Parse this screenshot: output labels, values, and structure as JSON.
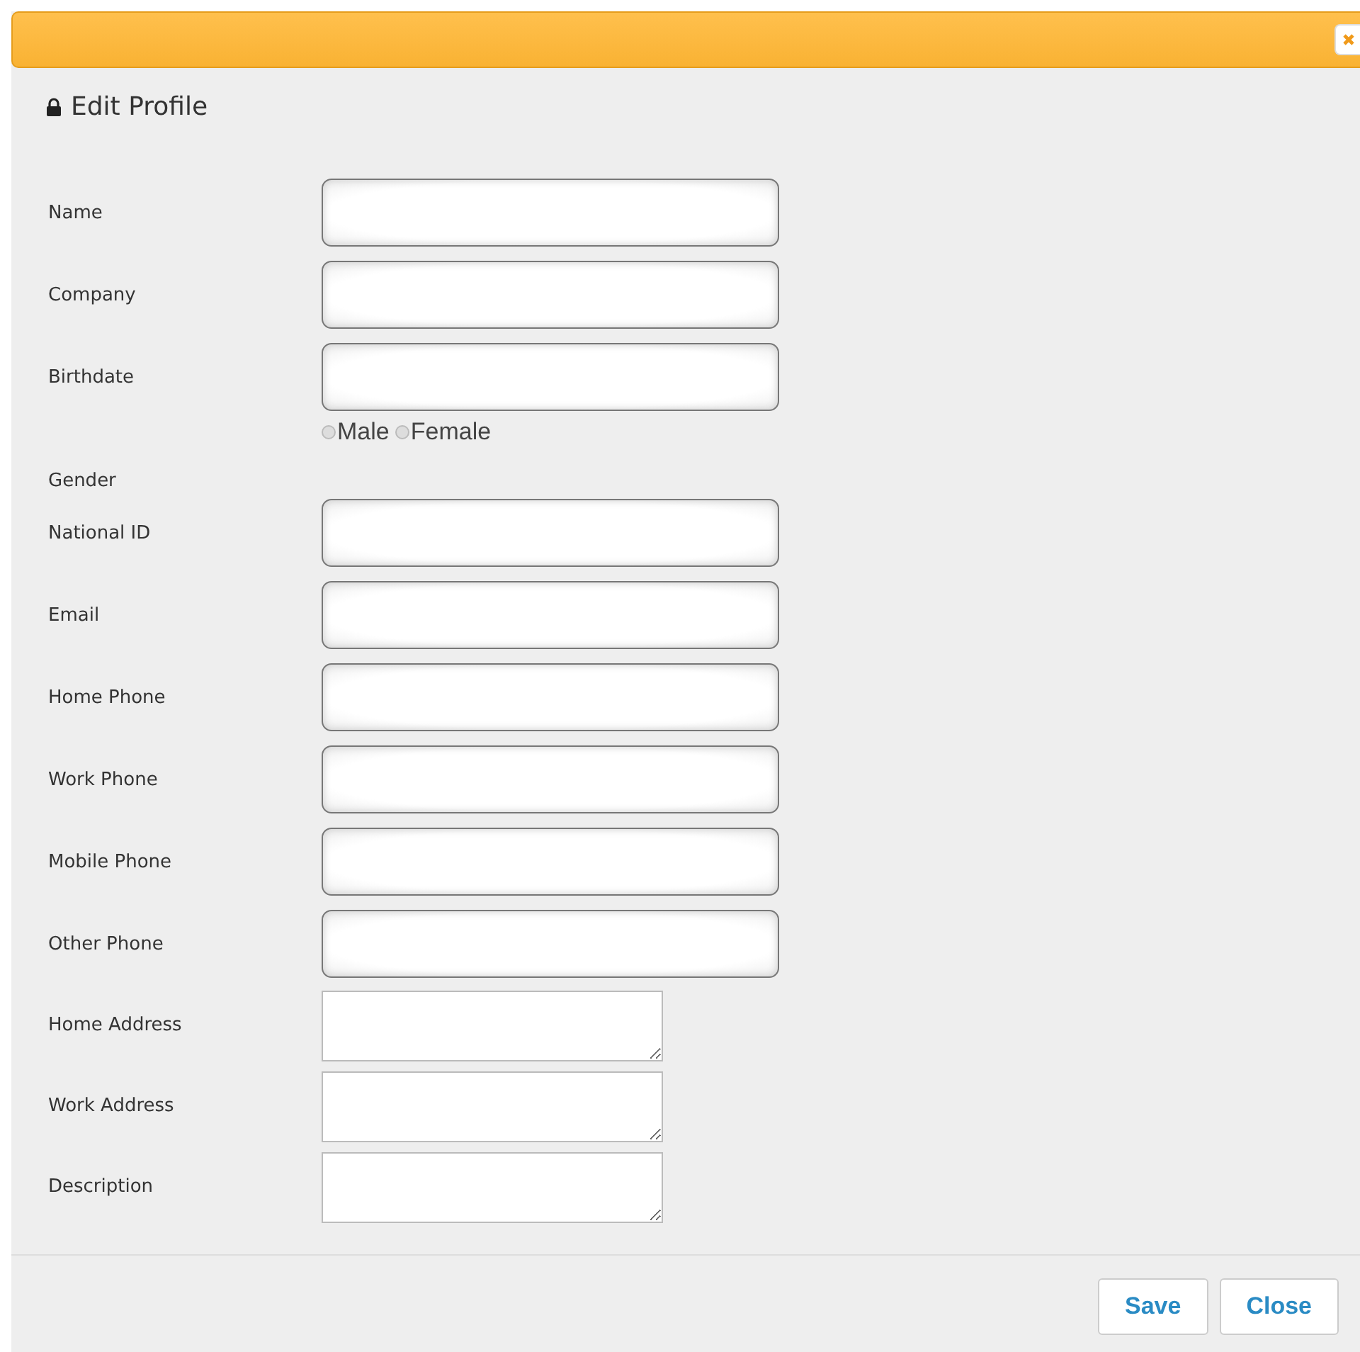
{
  "dialog": {
    "title": "Edit Profile"
  },
  "fields": [
    {
      "label": "Name",
      "kind": "text"
    },
    {
      "label": "Company",
      "kind": "text"
    },
    {
      "label": "Birthdate",
      "kind": "text"
    },
    {
      "label": "Gender",
      "kind": "radio",
      "options": [
        {
          "label": "Male",
          "selected": false
        },
        {
          "label": "Female",
          "selected": false
        }
      ]
    },
    {
      "label": "National ID",
      "kind": "text"
    },
    {
      "label": "Email",
      "kind": "text"
    },
    {
      "label": "Home Phone",
      "kind": "text"
    },
    {
      "label": "Work Phone",
      "kind": "text"
    },
    {
      "label": "Mobile Phone",
      "kind": "text"
    },
    {
      "label": "Other Phone",
      "kind": "text"
    },
    {
      "label": "Home Address",
      "kind": "textarea"
    },
    {
      "label": "Work Address",
      "kind": "textarea"
    },
    {
      "label": "Description",
      "kind": "textarea"
    }
  ],
  "buttons": [
    "Save",
    "Close"
  ]
}
